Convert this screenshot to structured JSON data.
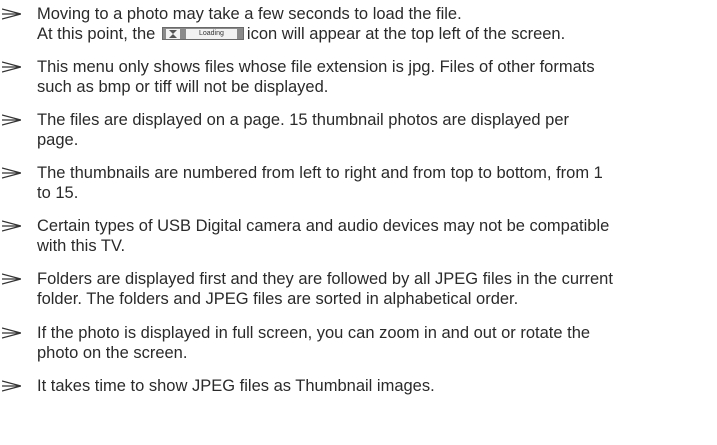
{
  "loading_label": "Loading",
  "notes": [
    {
      "line1": "Moving to a photo may take a few seconds to load the file.",
      "line2_before": "At this point, the",
      "line2_after": "icon will appear at the top left of the screen."
    },
    {
      "line1": "This menu only shows files whose file extension is jpg. Files of other formats",
      "line2": "such as bmp or tiff will not be displayed."
    },
    {
      "line1": "The files are displayed on a page. 15 thumbnail photos are displayed per",
      "line2": "page."
    },
    {
      "line1": "The thumbnails are numbered from left to right and from top to bottom, from 1",
      "line2": "to 15."
    },
    {
      "line1": "Certain types of USB Digital camera and audio devices may not be compatible",
      "line2": "with this TV."
    },
    {
      "line1": "Folders are displayed first and they are followed by all JPEG files in the current",
      "line2": "folder. The folders and JPEG files are sorted in alphabetical order."
    },
    {
      "line1": "If the photo is displayed in full screen, you can zoom in and out or rotate the",
      "line2": "photo on the screen."
    },
    {
      "line1": "It takes time to show JPEG files as Thumbnail images."
    }
  ]
}
